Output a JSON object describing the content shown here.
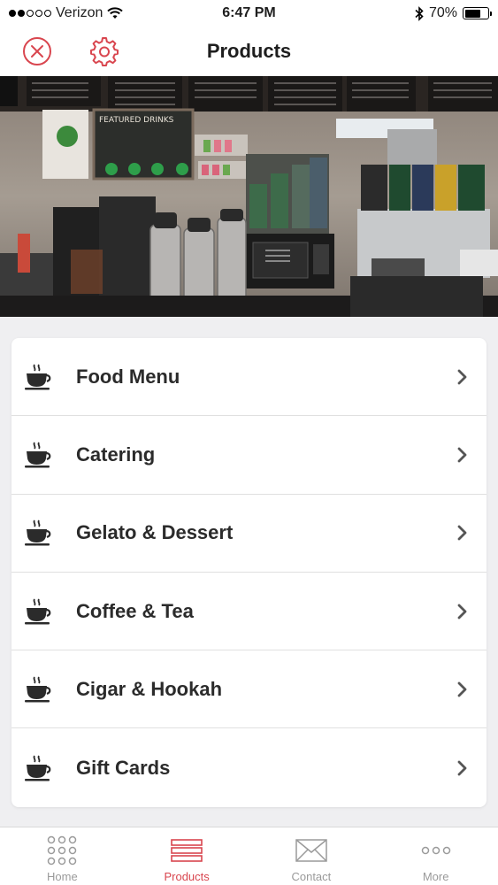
{
  "status_bar": {
    "carrier": "Verizon",
    "time": "6:47 PM",
    "battery": "70%",
    "battery_level": 0.7,
    "signal_bars_filled": 2,
    "signal_bars_total": 5
  },
  "nav": {
    "title": "Products",
    "accent_color": "#d9464f"
  },
  "hero": {
    "sign_text": "FEATURED DRINKS"
  },
  "menu": {
    "items": [
      {
        "label": "Food Menu",
        "icon": "coffee-cup-icon"
      },
      {
        "label": "Catering",
        "icon": "coffee-cup-icon"
      },
      {
        "label": "Gelato & Dessert",
        "icon": "coffee-cup-icon"
      },
      {
        "label": "Coffee & Tea",
        "icon": "coffee-cup-icon"
      },
      {
        "label": "Cigar & Hookah",
        "icon": "coffee-cup-icon"
      },
      {
        "label": "Gift Cards",
        "icon": "coffee-cup-icon"
      }
    ]
  },
  "tabs": [
    {
      "label": "Home",
      "icon": "grid-dots-icon",
      "active": false
    },
    {
      "label": "Products",
      "icon": "list-icon",
      "active": true
    },
    {
      "label": "Contact",
      "icon": "envelope-icon",
      "active": false
    },
    {
      "label": "More",
      "icon": "more-dots-icon",
      "active": false
    }
  ]
}
